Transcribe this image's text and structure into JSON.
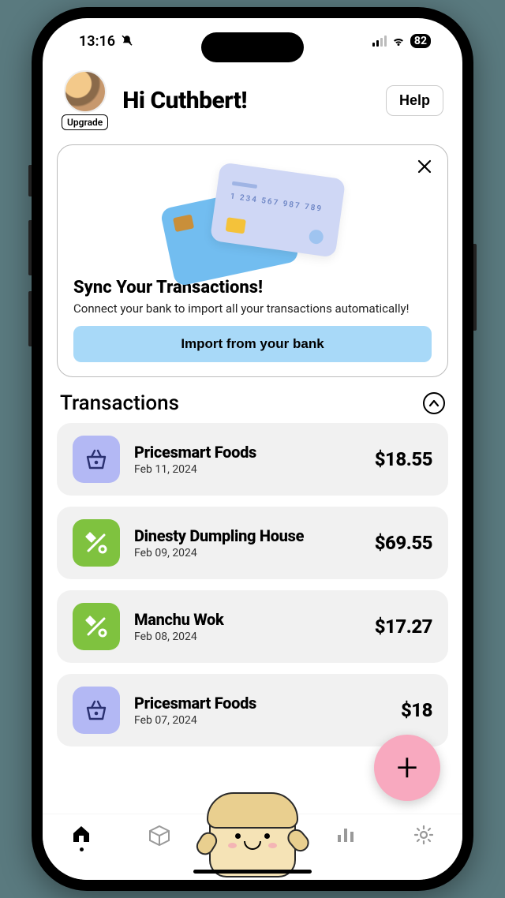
{
  "status": {
    "time": "13:16",
    "battery": "82"
  },
  "header": {
    "greeting": "Hi Cuthbert!",
    "upgrade_label": "Upgrade",
    "help_label": "Help"
  },
  "sync_card": {
    "title": "Sync Your Transactions!",
    "subtitle": "Connect your bank to import all your transactions automatically!",
    "button_label": "Import from your bank",
    "card_number_hint": "1 234 567 987 789"
  },
  "transactions": {
    "heading": "Transactions",
    "items": [
      {
        "name": "Pricesmart Foods",
        "date": "Feb 11, 2024",
        "amount": "$18.55",
        "icon": "basket"
      },
      {
        "name": "Dinesty Dumpling House",
        "date": "Feb 09, 2024",
        "amount": "$69.55",
        "icon": "food"
      },
      {
        "name": "Manchu Wok",
        "date": "Feb 08, 2024",
        "amount": "$17.27",
        "icon": "food"
      },
      {
        "name": "Pricesmart Foods",
        "date": "Feb 07, 2024",
        "amount": "$18",
        "icon": "basket"
      }
    ]
  }
}
